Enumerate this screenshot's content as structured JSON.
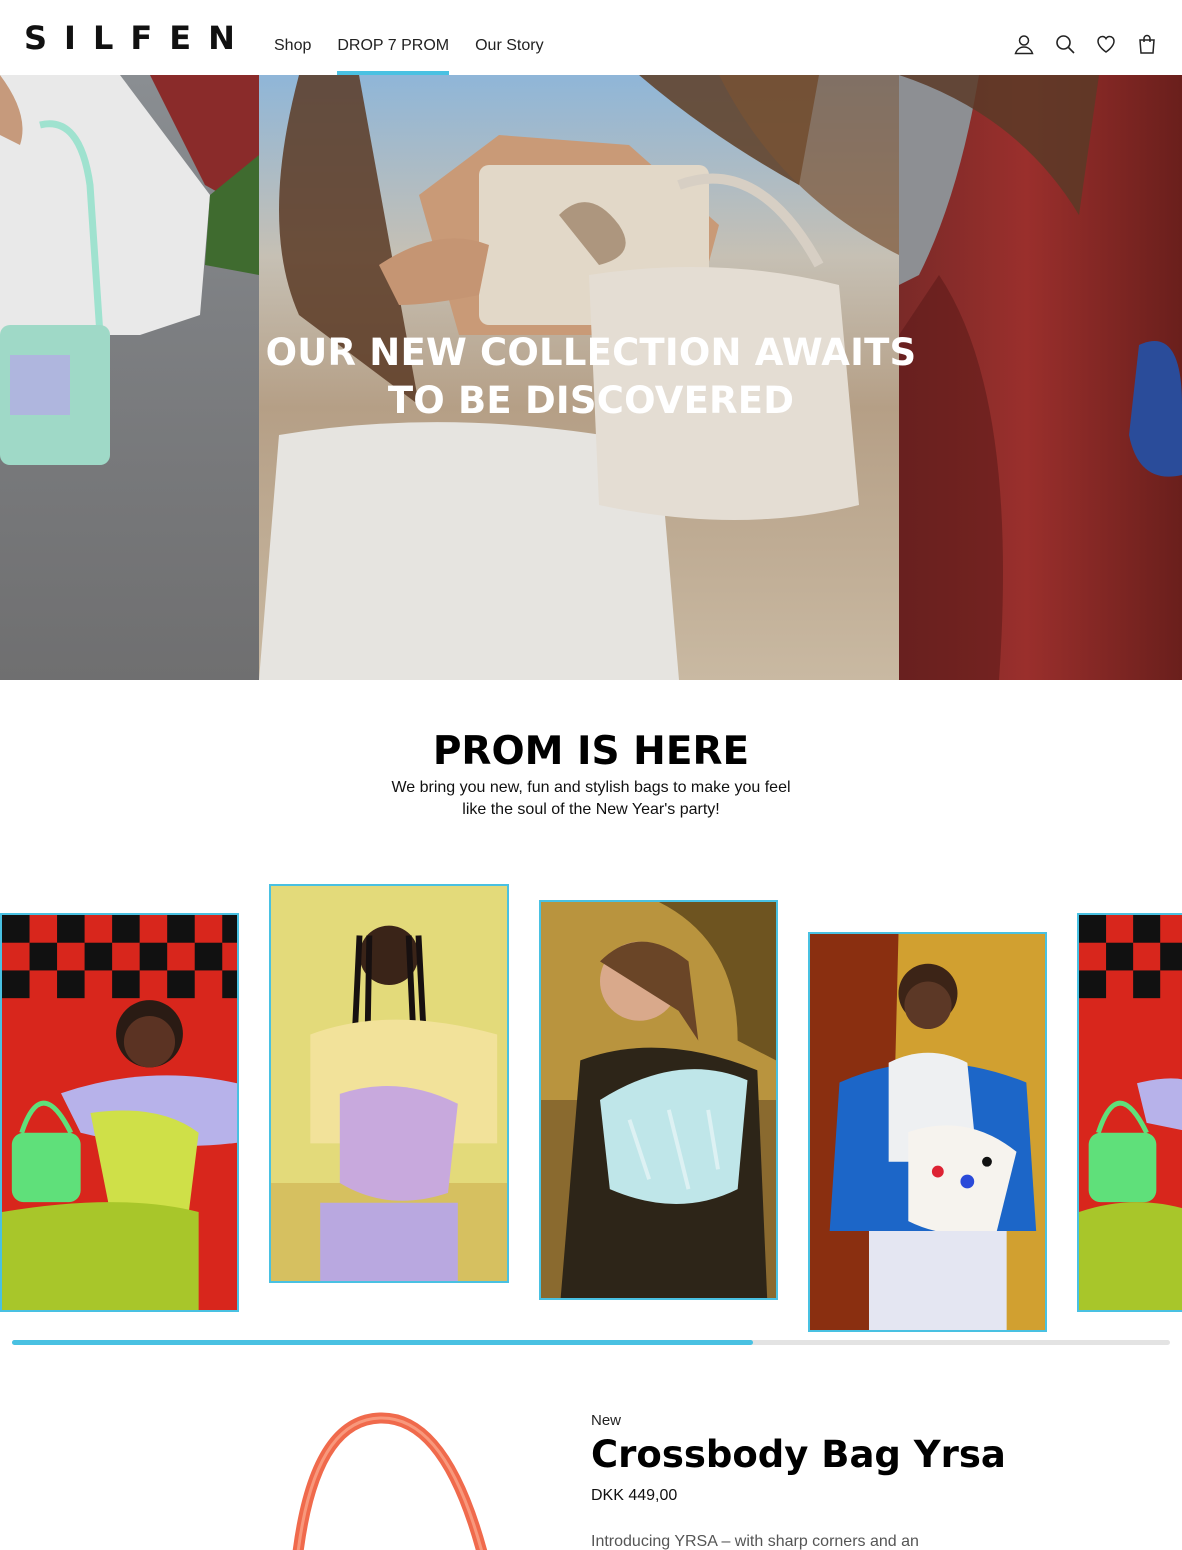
{
  "header": {
    "logo": "SILFEN",
    "nav": [
      {
        "label": "Shop",
        "active": false
      },
      {
        "label": "DROP 7 PROM",
        "active": true
      },
      {
        "label": "Our Story",
        "active": false
      }
    ],
    "icons": [
      "account-icon",
      "search-icon",
      "wishlist-heart-icon",
      "cart-bag-icon"
    ],
    "accent_color": "#49c1e2"
  },
  "hero": {
    "title": "OUR NEW COLLECTION AWAITS TO BE DISCOVERED"
  },
  "prom": {
    "title": "PROM IS HERE",
    "subtitle": "We bring you new, fun and stylish bags to make you feel like the soul of the New Year's party!"
  },
  "gallery": {
    "cards": [
      {
        "name": "gallery-card-green-bag"
      },
      {
        "name": "gallery-card-lilac-bag"
      },
      {
        "name": "gallery-card-iridescent-bag"
      },
      {
        "name": "gallery-card-printed-bag"
      },
      {
        "name": "gallery-card-green-bag-repeat"
      }
    ],
    "progress": 0.64
  },
  "product": {
    "label": "New",
    "title": "Crossbody Bag Yrsa",
    "price": "DKK 449,00",
    "description": "Introducing YRSA – with sharp corners and an"
  }
}
